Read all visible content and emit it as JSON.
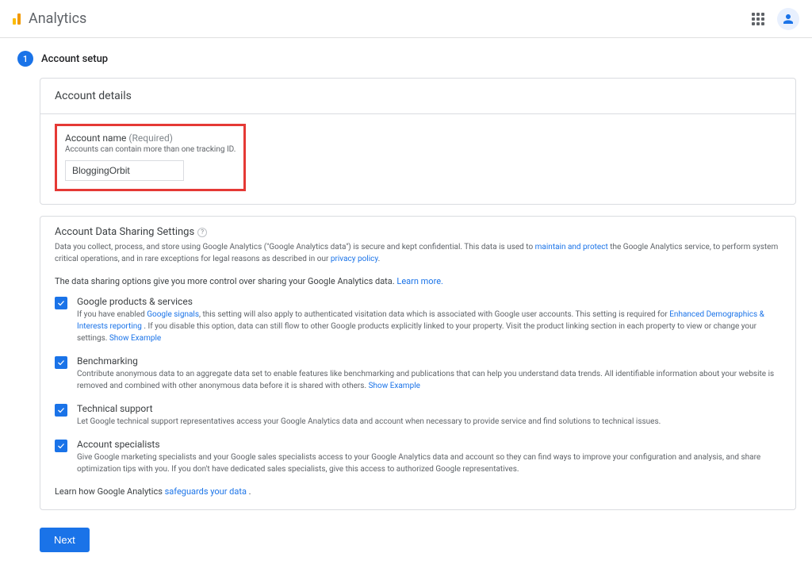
{
  "app_title": "Analytics",
  "step": {
    "number": "1",
    "title": "Account setup"
  },
  "details": {
    "header": "Account details",
    "field_label": "Account name",
    "required": "(Required)",
    "help": "Accounts can contain more than one tracking ID.",
    "value": "BloggingOrbit"
  },
  "sharing": {
    "title": "Account Data Sharing Settings",
    "intro_a": "Data you collect, process, and store using Google Analytics (\"Google Analytics data\") is secure and kept confidential. This data is used to ",
    "intro_link1": "maintain and protect",
    "intro_b": " the Google Analytics service, to perform system critical operations, and in rare exceptions for legal reasons as described in our ",
    "intro_link2": "privacy policy",
    "intro_c": ".",
    "lead": "The data sharing options give you more control over sharing your Google Analytics data. ",
    "learn_more": "Learn more.",
    "opt1": {
      "title": "Google products & services",
      "d1": "If you have enabled ",
      "l1": "Google signals",
      "d2": ", this setting will also apply to authenticated visitation data which is associated with Google user accounts. This setting is required for ",
      "l2": "Enhanced Demographics & Interests reporting",
      "d3": " . If you disable this option, data can still flow to other Google products explicitly linked to your property. Visit the product linking section in each property to view or change your settings.   ",
      "show": "Show Example"
    },
    "opt2": {
      "title": "Benchmarking",
      "d1": "Contribute anonymous data to an aggregate data set to enable features like benchmarking and publications that can help you understand data trends. All identifiable information about your website is removed and combined with other anonymous data before it is shared with others.   ",
      "show": "Show Example"
    },
    "opt3": {
      "title": "Technical support",
      "d1": "Let Google technical support representatives access your Google Analytics data and account when necessary to provide service and find solutions to technical issues."
    },
    "opt4": {
      "title": "Account specialists",
      "d1": "Give Google marketing specialists and your Google sales specialists access to your Google Analytics data and account so they can find ways to improve your configuration and analysis, and share optimization tips with you. If you don't have dedicated sales specialists, give this access to authorized Google representatives."
    },
    "footer_a": "Learn how Google Analytics ",
    "footer_link": "safeguards your data",
    "footer_b": " ."
  },
  "next": "Next"
}
